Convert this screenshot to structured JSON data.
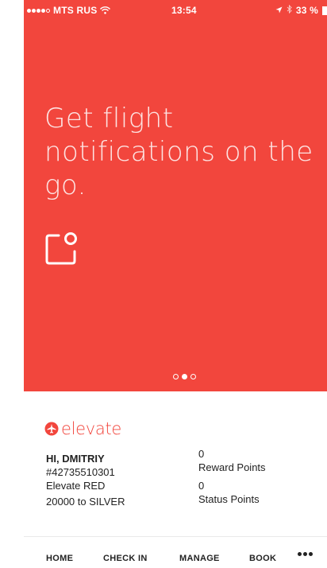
{
  "status_bar": {
    "carrier": "MTS RUS",
    "time": "13:54",
    "battery": "33 %"
  },
  "hero": {
    "headline": "Get flight notifications on the go.",
    "icon": "notification-icon",
    "pager": {
      "count": 3,
      "active_index": 1
    }
  },
  "brand": {
    "name": "elevate",
    "logo": "airplane-logo-icon"
  },
  "account": {
    "greeting": "HI, DMITRIY",
    "member_number": "#42735510301",
    "tier": "Elevate RED",
    "tier_progress": "20000 to SILVER",
    "reward_points_value": "0",
    "reward_points_label": "Reward Points",
    "status_points_value": "0",
    "status_points_label": "Status Points"
  },
  "nav": {
    "home": "HOME",
    "check_in": "CHECK IN",
    "manage": "MANAGE",
    "book": "BOOK",
    "more_icon": "more-dots-icon"
  },
  "colors": {
    "accent": "#f2463d",
    "text": "#222222"
  }
}
